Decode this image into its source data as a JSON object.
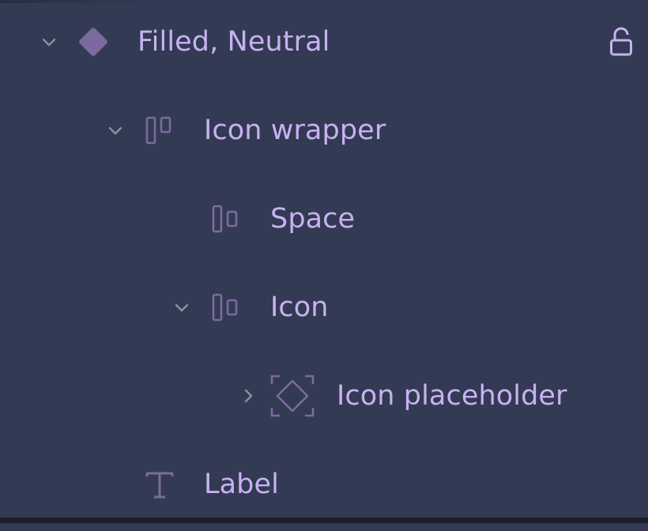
{
  "layers_panel": {
    "items": [
      {
        "label": "Filled, Neutral",
        "icon": "component-diamond-icon",
        "chevron": "expanded",
        "locked": true
      },
      {
        "label": "Icon wrapper",
        "icon": "auto-layout-icon",
        "chevron": "expanded"
      },
      {
        "label": "Space",
        "icon": "auto-layout-icon",
        "chevron": "none"
      },
      {
        "label": "Icon",
        "icon": "auto-layout-icon",
        "chevron": "expanded"
      },
      {
        "label": "Icon placeholder",
        "icon": "instance-icon",
        "chevron": "collapsed"
      },
      {
        "label": "Label",
        "icon": "text-icon",
        "chevron": "none"
      }
    ]
  },
  "colors": {
    "background": "#333a53",
    "label_text": "#c8b1f2",
    "icon_purple": "#7c6a9e",
    "chevron_gray": "#8a8fa4",
    "bottom_bar": "#1d1f2a"
  }
}
